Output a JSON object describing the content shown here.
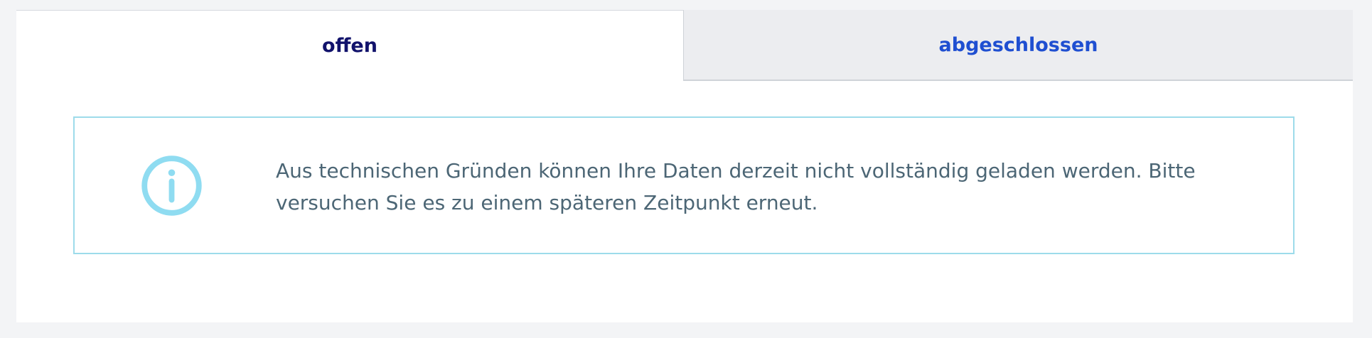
{
  "tabs": {
    "open_label": "offen",
    "closed_label": "abgeschlossen"
  },
  "notice": {
    "icon": "info-circle-icon",
    "text": "Aus technischen Gründen können Ihre Daten derzeit nicht vollständig geladen werden. Bitte versuchen Sie es zu einem späteren Zeitpunkt erneut."
  },
  "colors": {
    "active_tab_text": "#11126b",
    "inactive_tab_text": "#1f4fd1",
    "notice_border": "#9ddbea",
    "notice_text": "#4c6675"
  }
}
